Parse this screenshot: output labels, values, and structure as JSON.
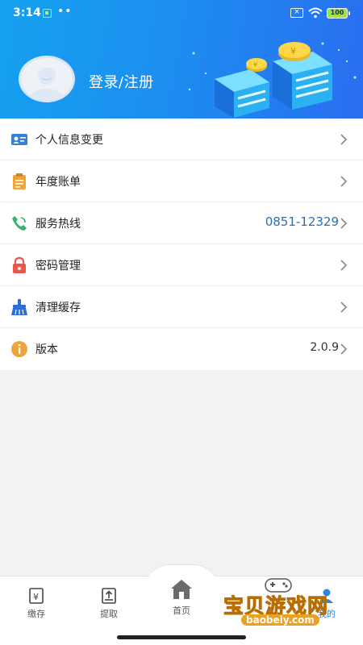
{
  "status_bar": {
    "time": "3:14",
    "dots": "••",
    "battery": "100"
  },
  "profile": {
    "login_label": "登录/注册"
  },
  "menu": {
    "items": [
      {
        "label": "个人信息变更",
        "value": "",
        "icon": "id-card-icon",
        "color": "#3a7fd6"
      },
      {
        "label": "年度账单",
        "value": "",
        "icon": "clipboard-icon",
        "color": "#f0a53a"
      },
      {
        "label": "服务热线",
        "value": "0851-12329",
        "icon": "phone-icon",
        "color": "#38b36a"
      },
      {
        "label": "密码管理",
        "value": "",
        "icon": "lock-icon",
        "color": "#e8574a"
      },
      {
        "label": "清理缓存",
        "value": "",
        "icon": "broom-icon",
        "color": "#2d6ed8"
      },
      {
        "label": "版本",
        "value": "2.0.9",
        "icon": "info-icon",
        "color": "#f0a53a"
      }
    ]
  },
  "tabbar": {
    "tabs": [
      {
        "label": "缴存",
        "icon": "deposit-icon"
      },
      {
        "label": "提取",
        "icon": "withdraw-icon"
      },
      {
        "label": "首页",
        "icon": "home-icon"
      },
      {
        "label": "我的",
        "icon": "profile-icon"
      }
    ]
  },
  "watermark": {
    "text": "宝贝游戏网",
    "url": "baobeiy.com"
  },
  "colors": {
    "header_start": "#14a1ee",
    "header_end": "#2a6df0",
    "link": "#2b6fb6"
  }
}
